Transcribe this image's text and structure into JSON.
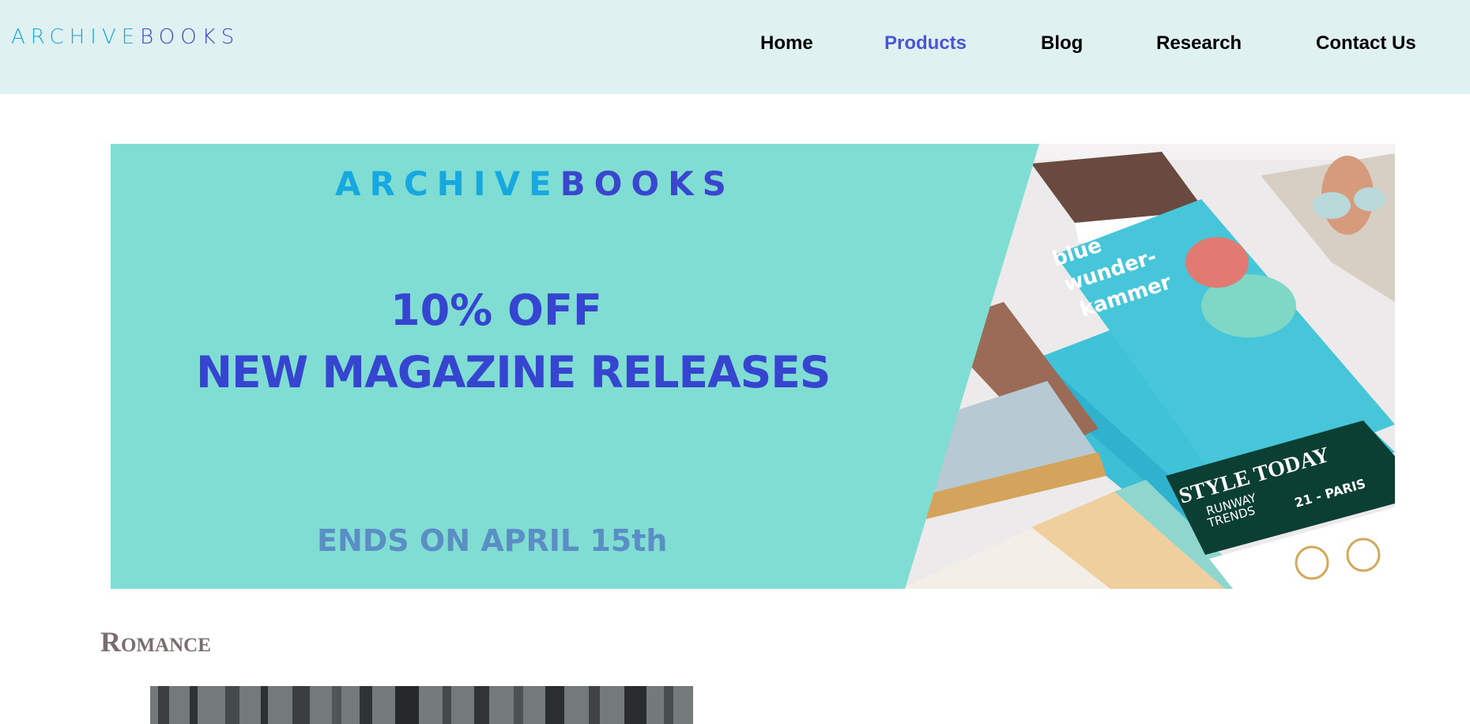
{
  "header": {
    "logo_part1": "ARCHIVE",
    "logo_part2": "BOOKS",
    "nav": [
      {
        "label": "Home",
        "active": false
      },
      {
        "label": "Products",
        "active": true
      },
      {
        "label": "Blog",
        "active": false
      },
      {
        "label": "Research",
        "active": false
      },
      {
        "label": "Contact Us",
        "active": false
      }
    ]
  },
  "banner": {
    "logo_part1": "ARCHIVE",
    "logo_part2": "BOOKS",
    "line1": "10% OFF",
    "line2": "NEW MAGAZINE RELEASES",
    "ends": "ENDS ON APRIL 15th",
    "photo_text": {
      "magazine1": [
        "blue",
        "wunder-",
        "kammer"
      ],
      "magazine2_title": "STYLE TODAY",
      "magazine2_sub": [
        "RUNWAY",
        "TRENDS"
      ],
      "magazine2_city": "21 - PARIS"
    }
  },
  "section": {
    "title": "Romance"
  },
  "colors": {
    "header_bg": "#dff1f0",
    "banner_bg": "#7fddd4",
    "accent": "#3545cf",
    "nav_active": "#4b56d6"
  }
}
